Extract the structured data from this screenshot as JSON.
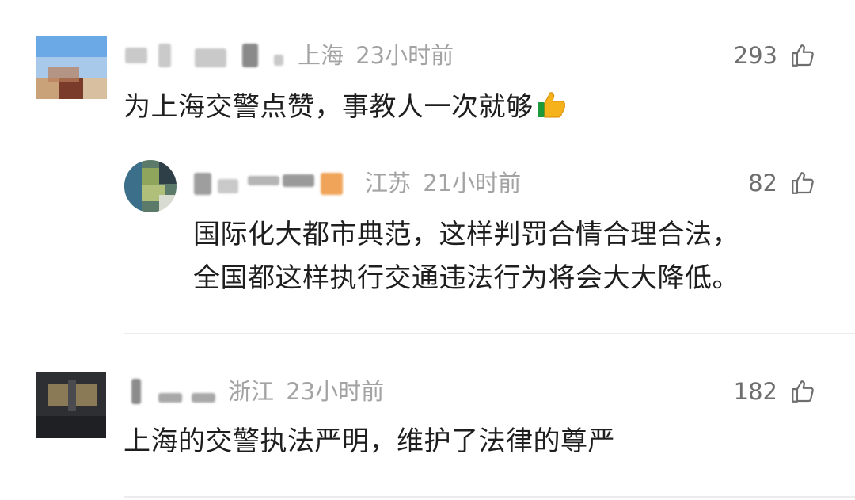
{
  "comments": [
    {
      "location": "上海",
      "time": "23小时前",
      "likes": "293",
      "text": "为上海交警点赞，事教人一次就够",
      "emoji": "thumbs-up-emoji"
    },
    {
      "location": "江苏",
      "time": "21小时前",
      "likes": "82",
      "text_line1": "国际化大都市典范，这样判罚合情合理合法，",
      "text_line2": "全国都这样执行交通违法行为将会大大降低。"
    },
    {
      "location": "浙江",
      "time": "23小时前",
      "likes": "182",
      "text": "上海的交警执法严明，维护了法律的尊严"
    }
  ],
  "colors": {
    "text": "#1e1e1e",
    "meta": "#a3a3a3",
    "count": "#6e6e6e",
    "divider": "#ececec"
  },
  "icons": [
    "thumbs-up-icon"
  ]
}
